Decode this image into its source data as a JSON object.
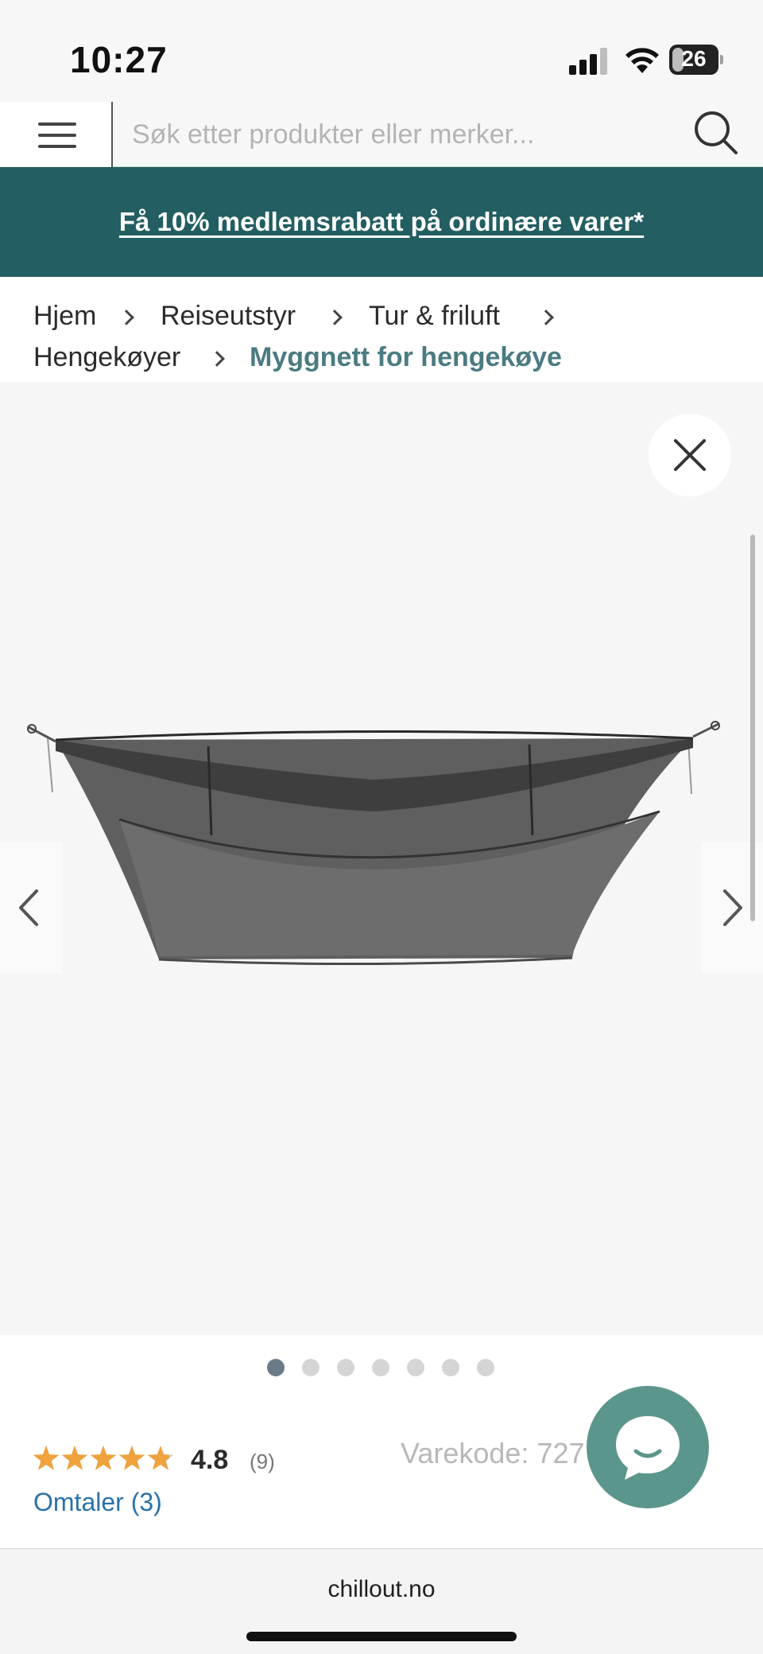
{
  "status_bar": {
    "time": "10:27",
    "battery_level": "26",
    "battery_fraction": 0.26
  },
  "header": {
    "search_placeholder": "Søk etter produkter eller merker..."
  },
  "promo": {
    "text": "Få 10% medlemsrabatt på ordinære varer*"
  },
  "breadcrumb": [
    {
      "label": "Hjem"
    },
    {
      "label": "Reiseutstyr"
    },
    {
      "label": "Tur & friluft"
    },
    {
      "label": "Hengekøyer"
    },
    {
      "label": "Myggnett for hengekøye"
    }
  ],
  "gallery": {
    "total_images": 7,
    "active_index": 0
  },
  "rating": {
    "value": "4.8",
    "count": "(9)",
    "stars_fraction": 0.96,
    "reviews_link": "Omtaler (3)"
  },
  "product": {
    "sku": "Varekode: 727      37"
  },
  "browser": {
    "url": "chillout.no"
  },
  "colors": {
    "promo_background": "#225e62",
    "breadcrumb_current": "#4a7b82",
    "star": "#f0a23c",
    "link": "#2a72a8",
    "chat_button": "#5b968c"
  },
  "icons": {
    "menu": "menu-icon",
    "search": "search-icon",
    "close": "close-icon",
    "prev": "chevron-left-icon",
    "next": "chevron-right-icon",
    "chat": "chat-bubble-icon"
  }
}
